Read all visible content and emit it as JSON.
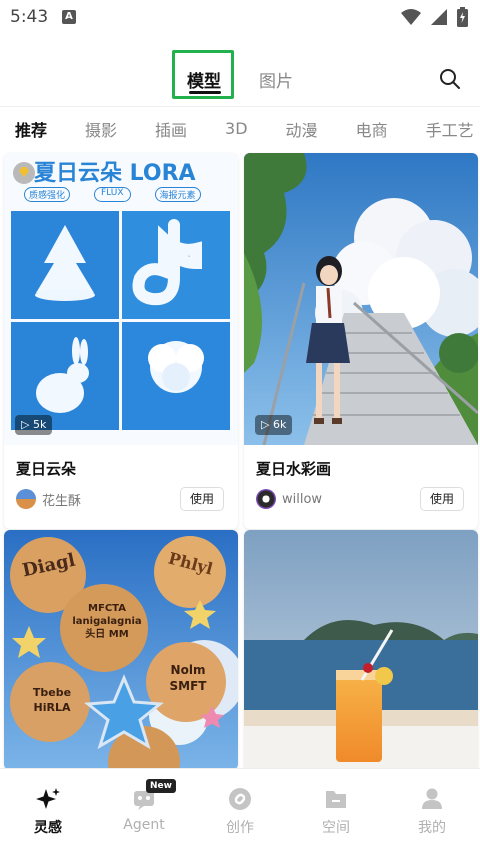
{
  "status_bar": {
    "time": "5:43",
    "notif_letter": "A"
  },
  "header": {
    "tabs": [
      {
        "label": "模型"
      },
      {
        "label": "图片"
      }
    ]
  },
  "categories": [
    "推荐",
    "摄影",
    "插画",
    "3D",
    "动漫",
    "电商",
    "手工艺"
  ],
  "cards": [
    {
      "poster_title": "夏日云朵 LORA",
      "poster_tags": [
        "质感强化",
        "FLUX",
        "海报元素"
      ],
      "views": "5k",
      "title": "夏日云朵",
      "author": "花生酥",
      "use_label": "使用"
    },
    {
      "views": "6k",
      "title": "夏日水彩画",
      "author": "willow",
      "use_label": "使用"
    },
    {
      "cookie_texts": [
        "Diagl",
        "Phlyl",
        "MFCTA\nlanigalagnia\n头日 MM",
        "Tbebe\nHiRLA",
        "Nolm\nSMFT"
      ]
    },
    {}
  ],
  "bottom_nav": [
    {
      "label": "灵感",
      "icon": "sparkle-icon",
      "active": true
    },
    {
      "label": "Agent",
      "icon": "agent-icon",
      "badge": "New"
    },
    {
      "label": "创作",
      "icon": "create-icon"
    },
    {
      "label": "空间",
      "icon": "folder-icon"
    },
    {
      "label": "我的",
      "icon": "person-icon"
    }
  ],
  "colors": {
    "accent_green": "#22b14c",
    "sky_blue": "#2f8fde"
  }
}
